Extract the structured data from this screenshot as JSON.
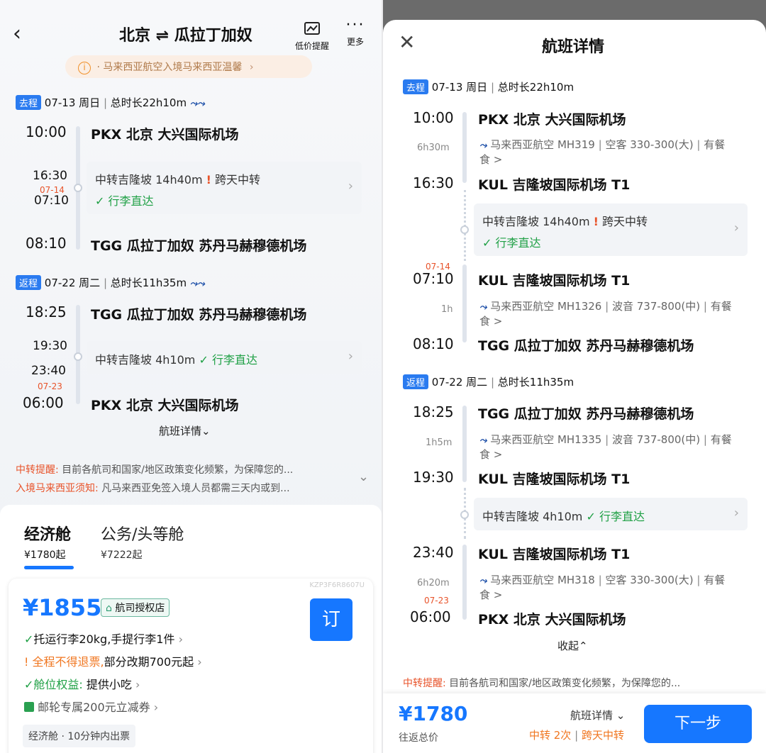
{
  "left": {
    "header": {
      "title": "北京 ⇌ 瓜拉丁加奴",
      "price_alert": "低价提醒",
      "more": "更多"
    },
    "notice": "· 马来西亚航空入境马来西亚温馨",
    "outbound": {
      "tag": "去程",
      "date": "07-13 周日",
      "duration": "总时长22h10m",
      "dep_time": "10:00",
      "dep_airport": "PKX  北京 大兴国际机场",
      "arr1_time": "16:30",
      "next_day": "07-14",
      "dep2_time": "07:10",
      "transfer": "中转吉隆坡 14h40m",
      "cross_day": "跨天中转",
      "baggage": "行李直达",
      "arr_time": "08:10",
      "arr_airport": "TGG  瓜拉丁加奴 苏丹马赫穆德机场"
    },
    "inbound": {
      "tag": "返程",
      "date": "07-22 周二",
      "duration": "总时长11h35m",
      "dep_time": "18:25",
      "dep_airport": "TGG  瓜拉丁加奴 苏丹马赫穆德机场",
      "arr1_time": "19:30",
      "dep2_time": "23:40",
      "next_day": "07-23",
      "transfer": "中转吉隆坡 4h10m",
      "baggage": "行李直达",
      "arr_time": "06:00",
      "arr_airport": "PKX  北京 大兴国际机场"
    },
    "details_link": "航班详情",
    "tips": [
      {
        "label": "中转提醒:",
        "text": "目前各航司和国家/地区政策变化频繁，为保障您的..."
      },
      {
        "label": "入境马来西亚须知:",
        "text": "凡马来西亚免签入境人员都需三天内或到..."
      }
    ],
    "cabins": [
      {
        "name": "经济舱",
        "price": "¥1780起"
      },
      {
        "name": "公务/头等舱",
        "price": "¥7222起"
      }
    ],
    "offer": {
      "code": "KZP3F6R8607U",
      "price": "¥1855",
      "badge": "航司授权店",
      "book": "订",
      "lines": [
        {
          "pre": "",
          "text": "托运行李20kg,手提行李1件"
        },
        {
          "pre": "全程不得退票,",
          "text": "部分改期700元起"
        },
        {
          "pre": "舱位权益:",
          "text": "提供小吃"
        },
        {
          "pre": "",
          "text": "邮轮专属200元立减券"
        }
      ],
      "footer": "经济舱 · 10分钟内出票"
    }
  },
  "right": {
    "title": "航班详情",
    "outbound": {
      "tag": "去程",
      "date": "07-13 周日",
      "duration": "总时长22h10m",
      "seg1": {
        "dep_time": "10:00",
        "dep": "PKX  北京 大兴国际机场",
        "flight": "马来西亚航空 MH319",
        "aircraft": "空客 330-300(大)",
        "meal": "有餐",
        "meal2": "食 >",
        "dur": "6h30m",
        "arr_time": "16:30",
        "arr": "KUL  吉隆坡国际机场 T1"
      },
      "transfer": "中转吉隆坡 14h40m",
      "cross_day": "跨天中转",
      "baggage": "行李直达",
      "seg2": {
        "next_day": "07-14",
        "dep_time": "07:10",
        "dep": "KUL  吉隆坡国际机场 T1",
        "flight": "马来西亚航空 MH1326",
        "aircraft": "波音 737-800(中)",
        "meal": "有餐",
        "meal2": "食 >",
        "dur": "1h",
        "arr_time": "08:10",
        "arr": "TGG  瓜拉丁加奴 苏丹马赫穆德机场"
      }
    },
    "inbound": {
      "tag": "返程",
      "date": "07-22 周二",
      "duration": "总时长11h35m",
      "seg1": {
        "dep_time": "18:25",
        "dep": "TGG  瓜拉丁加奴 苏丹马赫穆德机场",
        "flight": "马来西亚航空 MH1335",
        "aircraft": "波音 737-800(中)",
        "meal": "有餐",
        "meal2": "食 >",
        "dur": "1h5m",
        "arr_time": "19:30",
        "arr": "KUL  吉隆坡国际机场 T1"
      },
      "transfer": "中转吉隆坡 4h10m",
      "baggage": "行李直达",
      "seg2": {
        "dep_time": "23:40",
        "dep": "KUL  吉隆坡国际机场 T1",
        "flight": "马来西亚航空 MH318",
        "aircraft": "空客 330-300(大)",
        "meal": "有餐",
        "meal2": "食 >",
        "dur": "6h20m",
        "next_day": "07-23",
        "arr_time": "06:00",
        "arr": "PKX  北京 大兴国际机场"
      }
    },
    "collapse": "收起",
    "tip": {
      "label": "中转提醒:",
      "text": "目前各航司和国家/地区政策变化频繁，为保障您的..."
    },
    "bottom": {
      "price": "¥1780",
      "price_label": "往返总价",
      "details": "航班详情",
      "transfers": "中转 2次",
      "cross_day": "跨天中转",
      "next": "下一步"
    }
  }
}
